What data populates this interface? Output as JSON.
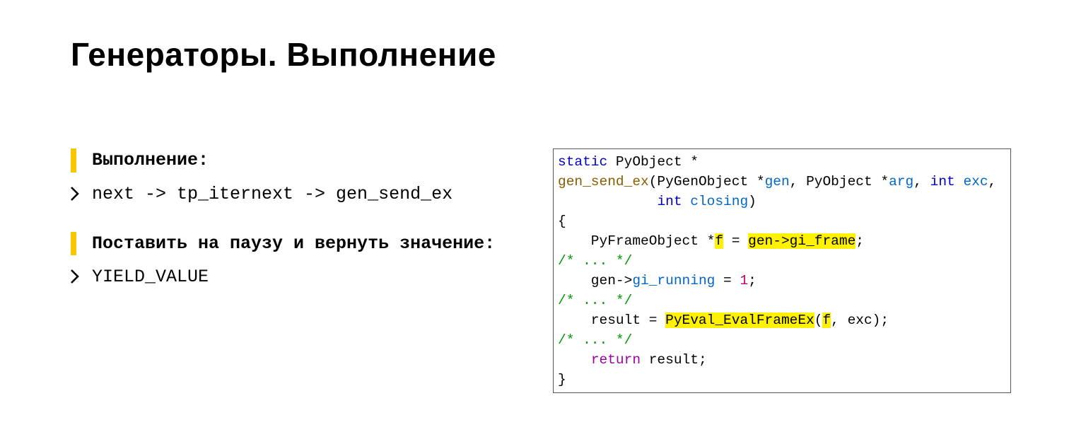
{
  "title": "Генераторы. Выполнение",
  "left": {
    "b1_title": "Выполнение:",
    "b1_line": "next -> tp_iternext -> gen_send_ex",
    "b2_title": "Поставить на паузу и вернуть значение:",
    "b2_line": "YIELD_VALUE"
  },
  "code": {
    "l1_static": "static",
    "l1_rest": " PyObject *",
    "l2_fn": "gen_send_ex",
    "l2_a": "(PyGenObject *",
    "l2_gen": "gen",
    "l2_b": ", PyObject *",
    "l2_arg": "arg",
    "l2_c": ", ",
    "l2_int1": "int",
    "l2_d": " ",
    "l2_exc": "exc",
    "l2_e": ",",
    "l3_pad": "            ",
    "l3_int": "int",
    "l3_sp": " ",
    "l3_closing": "closing",
    "l3_end": ")",
    "l4": "{",
    "l5_a": "    PyFrameObject *",
    "l5_f": "f",
    "l5_b": " = ",
    "l5_hl": "gen->gi_frame",
    "l5_c": ";",
    "l6": "/* ... */",
    "l7_a": "    gen->",
    "l7_run": "gi_running",
    "l7_b": " = ",
    "l7_num": "1",
    "l7_c": ";",
    "l8": "/* ... */",
    "l9_a": "    result = ",
    "l9_hl": "PyEval_EvalFrameEx",
    "l9_b": "(",
    "l9_f": "f",
    "l9_c": ", exc);",
    "l10": "/* ... */",
    "l11_a": "    ",
    "l11_ret": "return",
    "l11_b": " result;",
    "l12": "}"
  }
}
